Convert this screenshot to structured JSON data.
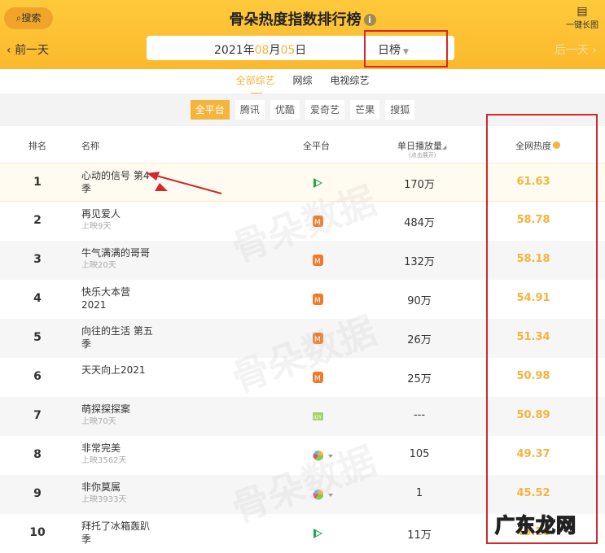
{
  "header": {
    "search_label": "搜索",
    "title": "骨朵热度指数排行榜",
    "info_icon": "i",
    "long_image_label": "一键长图",
    "prev_label": "前一天",
    "next_label": "后一天",
    "date": {
      "year": "2021",
      "year_unit": "年",
      "month": "08",
      "month_unit": "月",
      "day": "05",
      "day_unit": "日"
    },
    "period": "日榜"
  },
  "tabs": [
    "全部综艺",
    "网综",
    "电视综艺"
  ],
  "platforms": [
    "全平台",
    "腾讯",
    "优酷",
    "爱奇艺",
    "芒果",
    "搜狐"
  ],
  "columns": {
    "rank": "排名",
    "name": "名称",
    "platform": "全平台",
    "plays": "单日播放量",
    "plays_hint": "(点击展开)",
    "heat": "全网热度"
  },
  "rows": [
    {
      "rank": "1",
      "name": "心动的信号 第4季",
      "sub": "",
      "platform": "tencent",
      "plays": "170万",
      "heat": "61.63"
    },
    {
      "rank": "2",
      "name": "再见爱人",
      "sub": "上映9天",
      "platform": "mango",
      "plays": "484万",
      "heat": "58.78"
    },
    {
      "rank": "3",
      "name": "牛气满满的哥哥",
      "sub": "上映20天",
      "platform": "mango",
      "plays": "132万",
      "heat": "58.18"
    },
    {
      "rank": "4",
      "name": "快乐大本营2021",
      "sub": "",
      "platform": "mango",
      "plays": "90万",
      "heat": "54.91"
    },
    {
      "rank": "5",
      "name": "向往的生活 第五季",
      "sub": "",
      "platform": "mango",
      "plays": "26万",
      "heat": "51.34"
    },
    {
      "rank": "6",
      "name": "天天向上2021",
      "sub": "",
      "platform": "mango",
      "plays": "25万",
      "heat": "50.98"
    },
    {
      "rank": "7",
      "name": "萌探探探案",
      "sub": "上映70天",
      "platform": "iqiyi",
      "plays": "---",
      "heat": "50.89"
    },
    {
      "rank": "8",
      "name": "非常完美",
      "sub": "上映3562天",
      "platform": "multi",
      "plays": "105",
      "heat": "49.37"
    },
    {
      "rank": "9",
      "name": "非你莫属",
      "sub": "上映3933天",
      "platform": "multi",
      "plays": "1",
      "heat": "45.52"
    },
    {
      "rank": "10",
      "name": "拜托了冰箱轰趴季",
      "sub": "",
      "platform": "tencent",
      "plays": "11万",
      "heat": "45.26"
    }
  ],
  "watermark": "骨朵数据",
  "stamp": "广东龙网",
  "colors": {
    "accent": "#f5b43c",
    "header": "#fbc035",
    "annotation": "#d3282c"
  }
}
